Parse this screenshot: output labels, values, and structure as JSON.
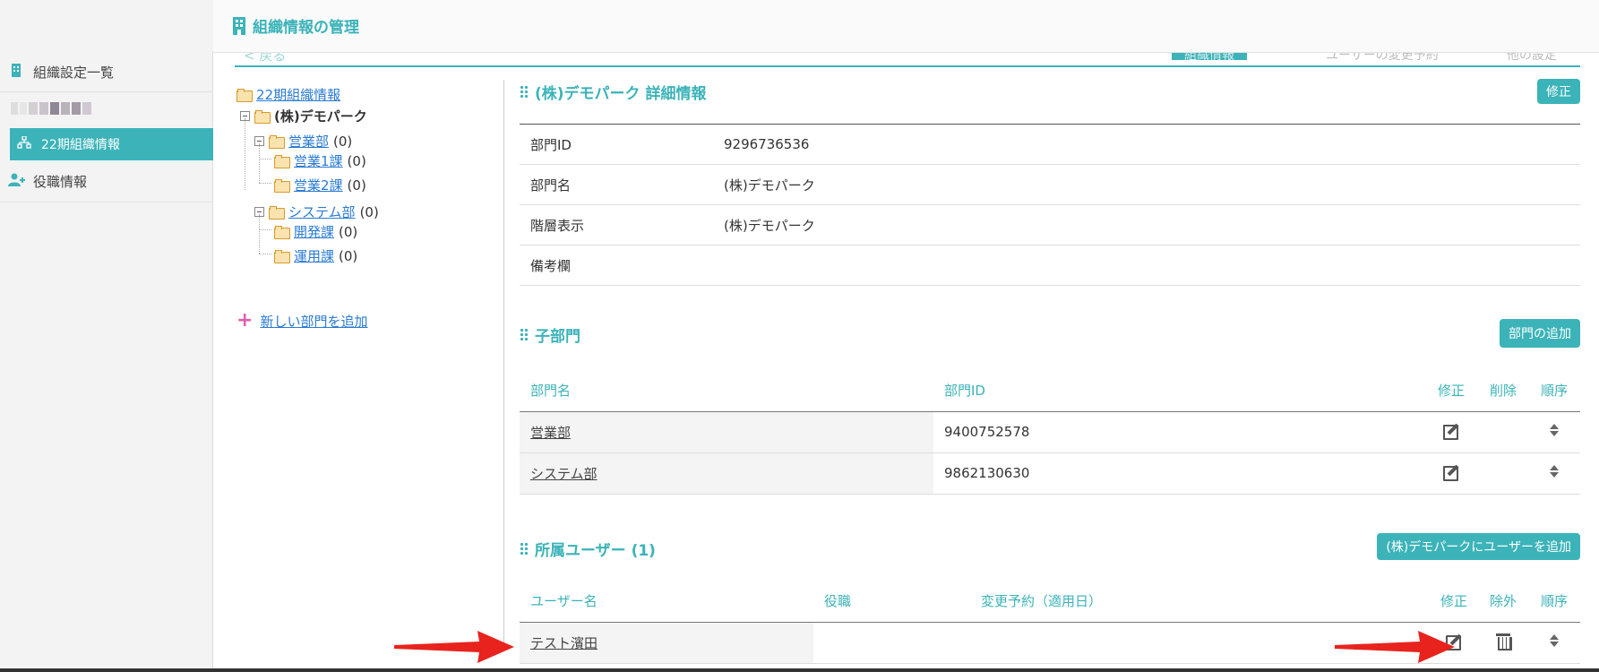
{
  "header": {
    "title": "組織情報の管理",
    "icon": "building-icon"
  },
  "sidebar": {
    "items": [
      {
        "label": "組織設定一覧",
        "icon": "building-icon"
      },
      {
        "label": "22期組織情報",
        "icon": "org-chart-icon",
        "active": true
      },
      {
        "label": "役職情報",
        "icon": "user-plus-icon"
      }
    ]
  },
  "tabs": {
    "back": "< 戻る",
    "items": [
      "組織情報",
      "ユーザーの変更予約",
      "他の設定"
    ]
  },
  "tree": {
    "root": "22期組織情報",
    "company": "(株)デモパーク",
    "nodes": [
      {
        "label": "営業部",
        "count": "(0)"
      },
      {
        "label": "営業1課",
        "count": "(0)"
      },
      {
        "label": "営業2課",
        "count": "(0)"
      },
      {
        "label": "システム部",
        "count": "(0)"
      },
      {
        "label": "開発課",
        "count": "(0)"
      },
      {
        "label": "運用課",
        "count": "(0)"
      }
    ],
    "add_label": "新しい部門を追加"
  },
  "detail": {
    "title": "(株)デモパーク 詳細情報",
    "edit_button": "修正",
    "rows": [
      {
        "key": "部門ID",
        "value": "9296736536"
      },
      {
        "key": "部門名",
        "value": "(株)デモパーク"
      },
      {
        "key": "階層表示",
        "value": "(株)デモパーク"
      },
      {
        "key": "備考欄",
        "value": ""
      }
    ]
  },
  "children": {
    "title": "子部門",
    "add_button": "部門の追加",
    "columns": [
      "部門名",
      "部門ID",
      "修正",
      "削除",
      "順序"
    ],
    "rows": [
      {
        "name": "営業部",
        "id": "9400752578"
      },
      {
        "name": "システム部",
        "id": "9862130630"
      }
    ]
  },
  "users": {
    "title": "所属ユーザー (1)",
    "add_button": "(株)デモパークにユーザーを追加",
    "columns": [
      "ユーザー名",
      "役職",
      "変更予約（適用日）",
      "修正",
      "除外",
      "順序"
    ],
    "rows": [
      {
        "name": "テスト濱田",
        "position": "",
        "reservation": ""
      }
    ]
  },
  "colors": {
    "accent": "#3bb3b9",
    "link": "#2a7bd4",
    "arrow": "#e8231e",
    "add_plus": "#e05fb0"
  }
}
